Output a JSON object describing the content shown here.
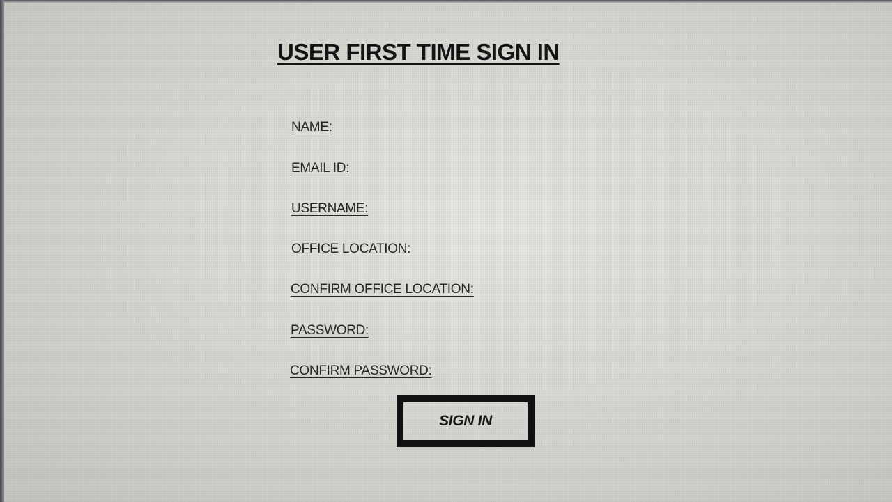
{
  "title": "USER FIRST TIME SIGN IN",
  "form": {
    "fields": {
      "name": "NAME:",
      "email_id": "EMAIL ID:",
      "username": "USERNAME:",
      "office_location": "OFFICE LOCATION:",
      "confirm_office_location": "CONFIRM OFFICE LOCATION:",
      "password": "PASSWORD:",
      "confirm_password": "CONFIRM PASSWORD:"
    },
    "submit_label": "SIGN IN"
  }
}
